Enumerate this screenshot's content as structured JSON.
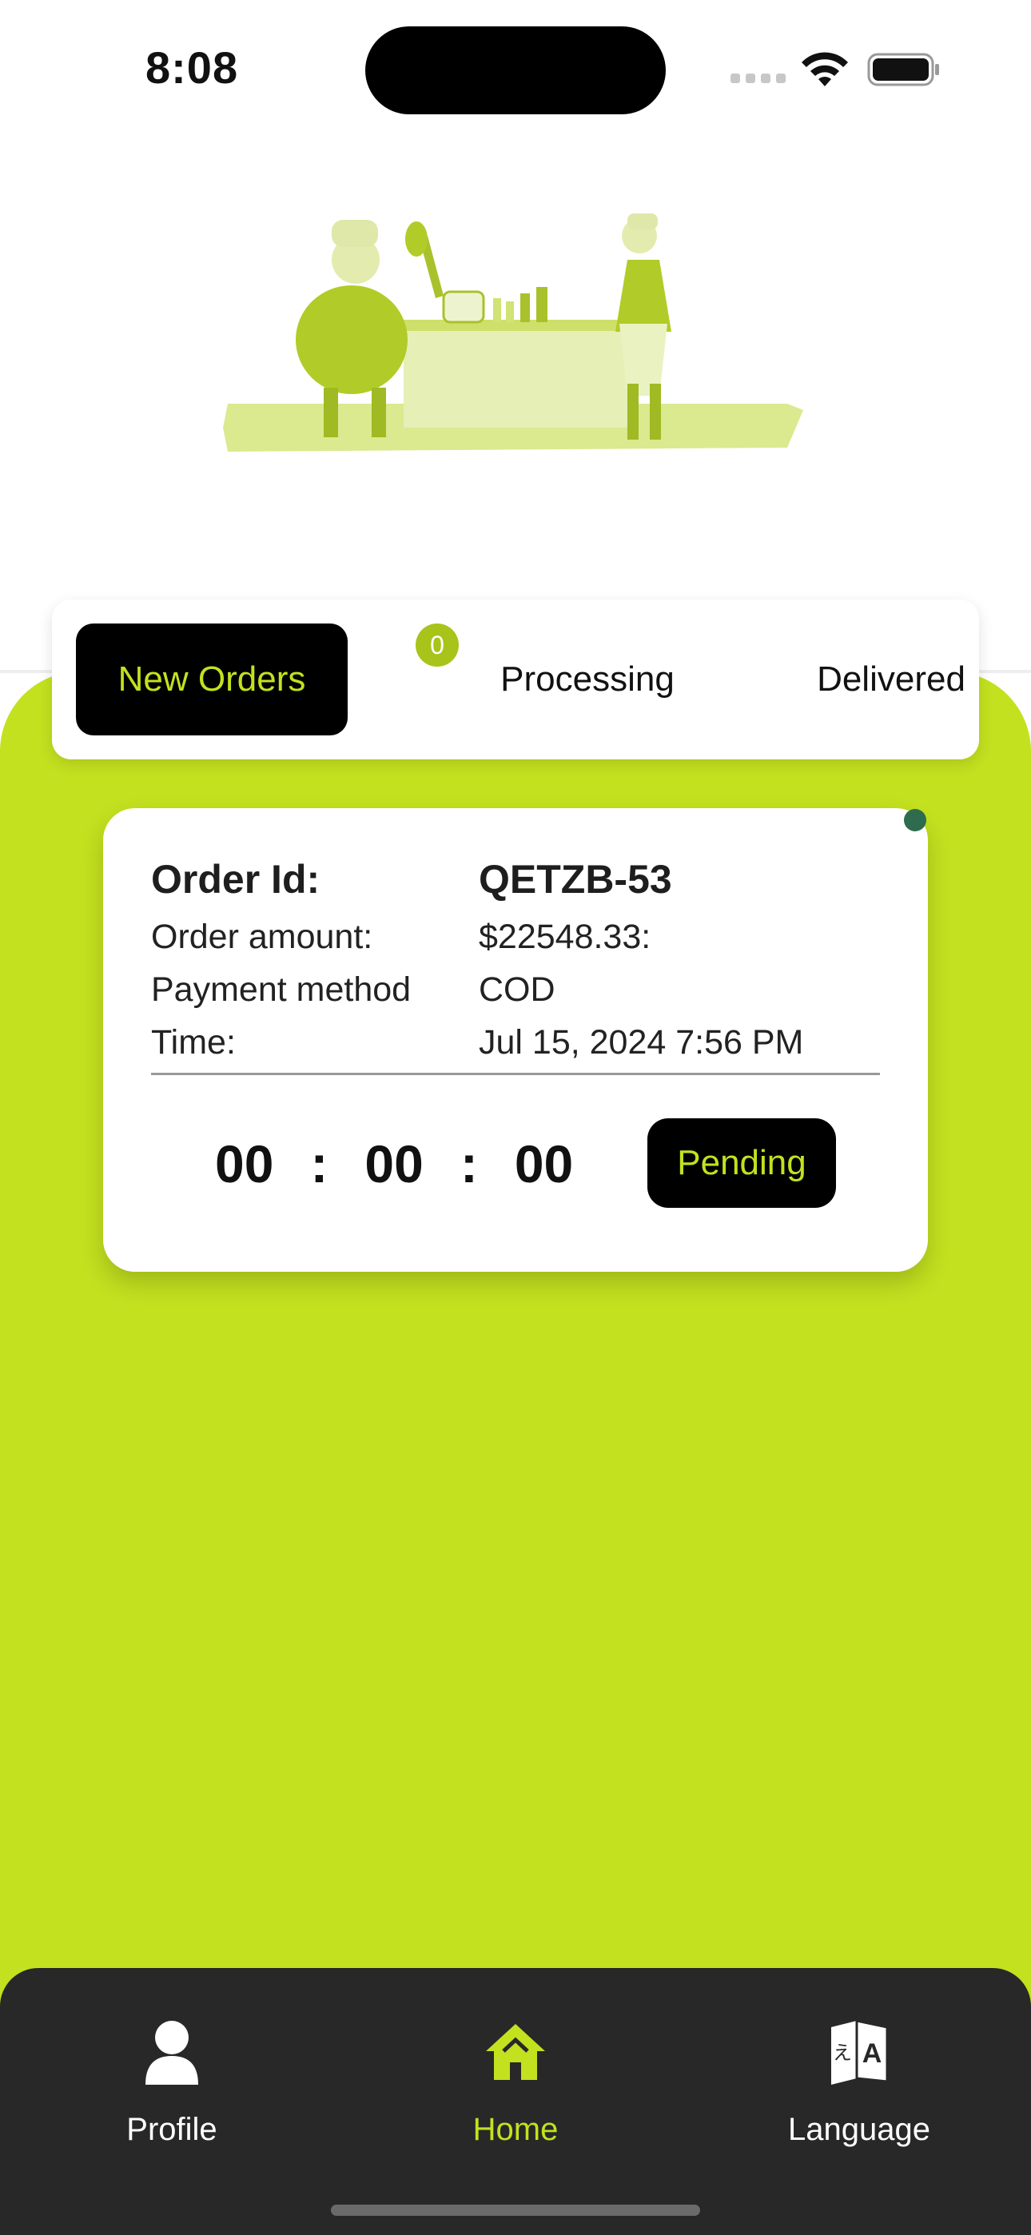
{
  "status_bar": {
    "time": "8:08",
    "icons": [
      "signal-icon",
      "wifi-icon",
      "battery-icon"
    ]
  },
  "tabs": {
    "items": [
      {
        "label": "New Orders",
        "active": true
      },
      {
        "label": "Processing",
        "badge": "0"
      },
      {
        "label": "Delivered"
      }
    ]
  },
  "order": {
    "id_label": "Order Id:",
    "id_value": "QETZB-53",
    "amount_label": "Order amount:",
    "amount_value": "$22548.33:",
    "payment_label": "Payment method",
    "payment_value": "COD",
    "time_label": "Time:",
    "time_value": "Jul 15, 2024 7:56 PM",
    "timer": {
      "hours": "00",
      "minutes": "00",
      "seconds": "00",
      "separator": ":"
    },
    "status_button": "Pending"
  },
  "bottom_nav": {
    "items": [
      {
        "label": "Profile",
        "icon": "person-icon"
      },
      {
        "label": "Home",
        "icon": "home-icon",
        "active": true
      },
      {
        "label": "Language",
        "icon": "translate-icon"
      }
    ]
  },
  "colors": {
    "accent": "#c3e11f",
    "dark": "#000000",
    "nav_bg": "#282828",
    "status_dot": "#2f6b4f"
  }
}
